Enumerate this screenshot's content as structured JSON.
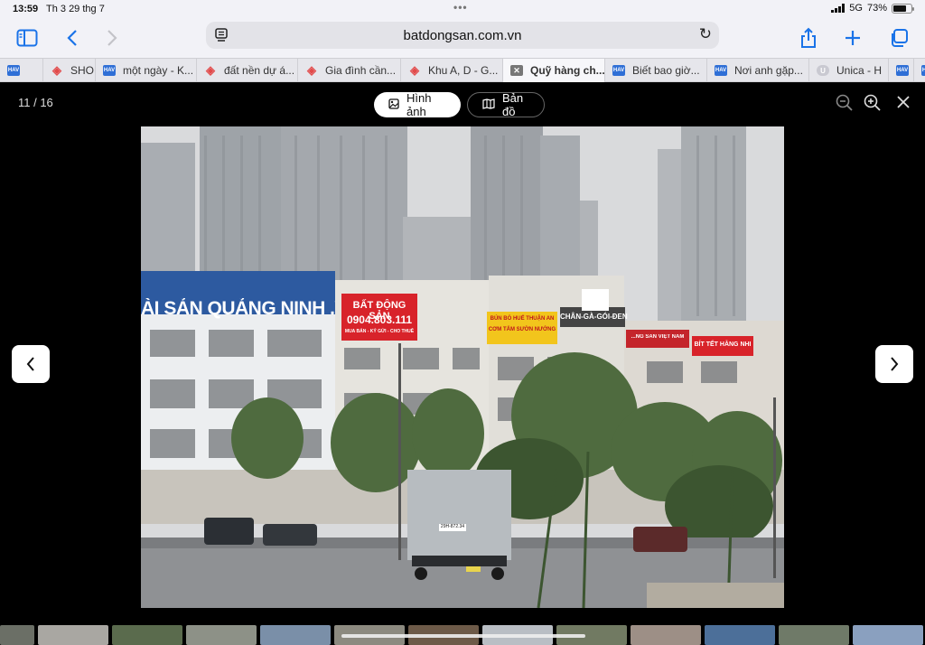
{
  "status": {
    "time": "13:59",
    "date": "Th 3 29 thg 7",
    "network": "5G",
    "battery": "73%",
    "battery_level": 0.73
  },
  "browser": {
    "url": "batdongsan.com.vn"
  },
  "tabs": [
    {
      "label": "",
      "icon": "hav"
    },
    {
      "label": "SHO",
      "icon": "bds"
    },
    {
      "label": "một ngày - K...",
      "icon": "hav"
    },
    {
      "label": "đất nền dự á...",
      "icon": "bds"
    },
    {
      "label": "Gia đình cần...",
      "icon": "bds"
    },
    {
      "label": "Khu A, D - G...",
      "icon": "bds"
    },
    {
      "label": "Quỹ hàng ch...",
      "icon": "close",
      "active": true
    },
    {
      "label": "Biết bao giờ...",
      "icon": "hav"
    },
    {
      "label": "Nơi anh gặp...",
      "icon": "hav"
    },
    {
      "label": "Unica - H",
      "icon": "unica"
    },
    {
      "label": "",
      "icon": "hav"
    },
    {
      "label": "",
      "icon": "hav"
    }
  ],
  "viewer": {
    "counter": "11 / 16",
    "tab_images": "Hình ảnh",
    "tab_map": "Bản đồ"
  },
  "photo": {
    "sign_building": "ÀI SẢN QUẢNG NINH .VN",
    "sign_red_title": "BẤT ĐỘNG SẢN",
    "sign_red_phone": "0904.803.111",
    "sign_red_sub": "MUA BÁN - KÝ GỬI - CHO THUÊ",
    "sign_yellow_1": "BÚN BÒ HUẾ THUẬN AN",
    "sign_yellow_2": "CƠM TẤM SƯỜN NƯỚNG",
    "sign_dark": "CHÂN-GÀ-GÓI-ĐEN",
    "sign_red2": "BÍT TẾT HẰNG NHI",
    "sign_red3": "...NG SẢN VIỆT NAM",
    "truck_plate": "29H-872.34"
  },
  "colors": {
    "accent": "#1a73e8",
    "brand": "#e24a4a",
    "hav": "#2f6fd6"
  }
}
